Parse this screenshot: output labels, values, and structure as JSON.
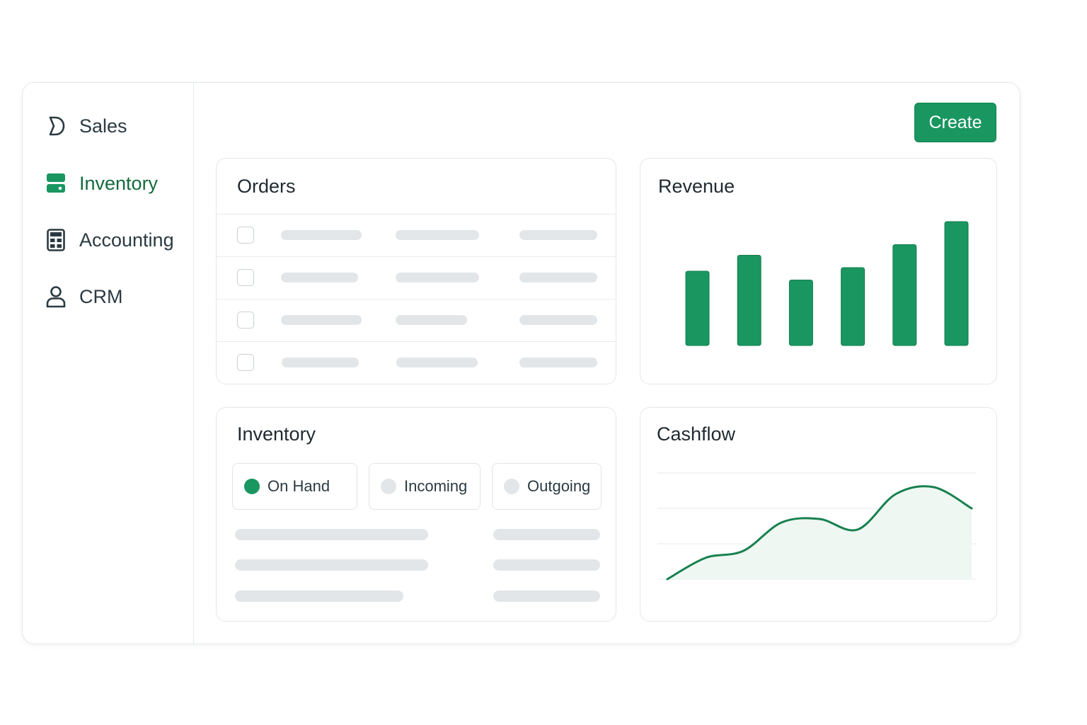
{
  "sidebar": {
    "items": [
      {
        "label": "Sales",
        "icon": "sales-icon",
        "active": false
      },
      {
        "label": "Inventory",
        "icon": "inventory-icon",
        "active": true
      },
      {
        "label": "Accounting",
        "icon": "calculator-icon",
        "active": false
      },
      {
        "label": "CRM",
        "icon": "user-icon",
        "active": false
      }
    ]
  },
  "toolbar": {
    "create_label": "Create"
  },
  "orders": {
    "title": "Orders"
  },
  "revenue": {
    "title": "Revenue"
  },
  "inventory": {
    "title": "Inventory",
    "tabs": [
      {
        "label": "On Hand",
        "selected": true
      },
      {
        "label": "Incoming",
        "selected": false
      },
      {
        "label": "Outgoing",
        "selected": false
      }
    ]
  },
  "cashflow": {
    "title": "Cashflow"
  },
  "colors": {
    "accent": "#1a9660",
    "active_text": "#136b3c",
    "placeholder": "#e3e6e8"
  },
  "chart_data": [
    {
      "type": "bar",
      "categories": [
        "",
        "",
        "",
        "",
        "",
        ""
      ],
      "values": [
        42,
        51,
        37,
        44,
        57,
        70
      ],
      "ylim": [
        0,
        72
      ],
      "grid": false
    },
    {
      "type": "area",
      "x": [
        0,
        1,
        2,
        3,
        4,
        5,
        6,
        7,
        8
      ],
      "values": [
        0,
        12,
        16,
        32,
        34,
        28,
        48,
        52,
        40
      ],
      "ylim": [
        0,
        60
      ],
      "grid": true
    }
  ]
}
